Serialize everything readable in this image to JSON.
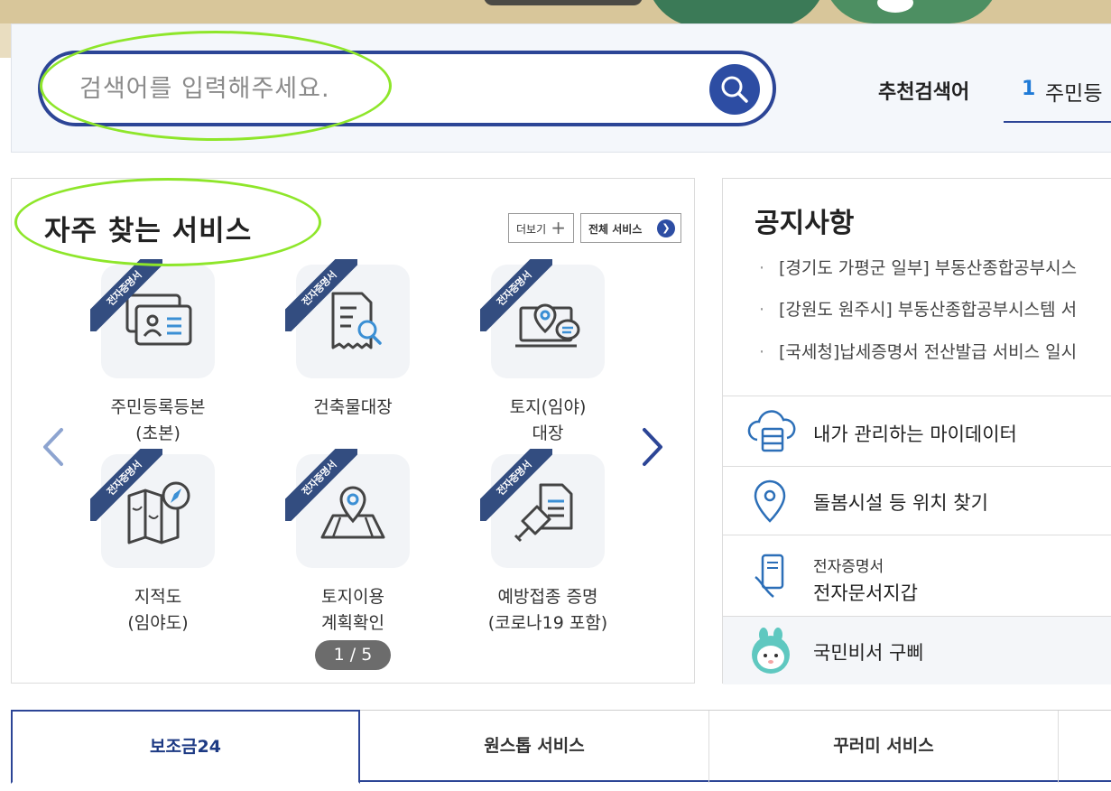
{
  "search": {
    "placeholder": "검색어를 입력해주세요.",
    "recommend_label": "추천검색어",
    "recommend_items": [
      {
        "rank": "1",
        "text": "주민등"
      }
    ]
  },
  "services": {
    "title": "자주 찾는 서비스",
    "more_label": "더보기",
    "all_label": "전체 서비스",
    "badge": "전자증명서",
    "pager": "1 / 5",
    "items": [
      {
        "line1": "주민등록등본",
        "line2": "(초본)",
        "icon": "id-card-icon"
      },
      {
        "line1": "건축물대장",
        "line2": "",
        "icon": "document-search-icon"
      },
      {
        "line1": "토지(임야)",
        "line2": "대장",
        "icon": "laptop-location-icon"
      },
      {
        "line1": "지적도",
        "line2": "(임야도)",
        "icon": "map-compass-icon"
      },
      {
        "line1": "토지이용",
        "line2": "계획확인",
        "icon": "map-pin-icon"
      },
      {
        "line1": "예방접종 증명",
        "line2": "(코로나19 포함)",
        "icon": "syringe-document-icon"
      }
    ]
  },
  "notice": {
    "title": "공지사항",
    "items": [
      "[경기도 가평군 일부] 부동산종합공부시스",
      "[강원도 원주시] 부동산종합공부시스템 서",
      "[국세청]납세증명서 전산발급 서비스 일시"
    ]
  },
  "quick_links": {
    "my_data": "내가 관리하는 마이데이터",
    "care_location": "돌봄시설 등 위치 찾기",
    "wallet_sub": "전자증명서",
    "wallet": "전자문서지갑",
    "assistant": "국민비서 구삐"
  },
  "tabs": [
    {
      "label": "보조금24",
      "active": true
    },
    {
      "label": "원스톱 서비스",
      "active": false
    },
    {
      "label": "꾸러미 서비스",
      "active": false
    },
    {
      "label": "",
      "active": false
    }
  ],
  "colors": {
    "brand_navy": "#2c4596",
    "accent_blue": "#2d4da3",
    "ribbon": "#334d80",
    "highlight_green": "#8ee62a",
    "rank_blue": "#1e7ad6"
  }
}
